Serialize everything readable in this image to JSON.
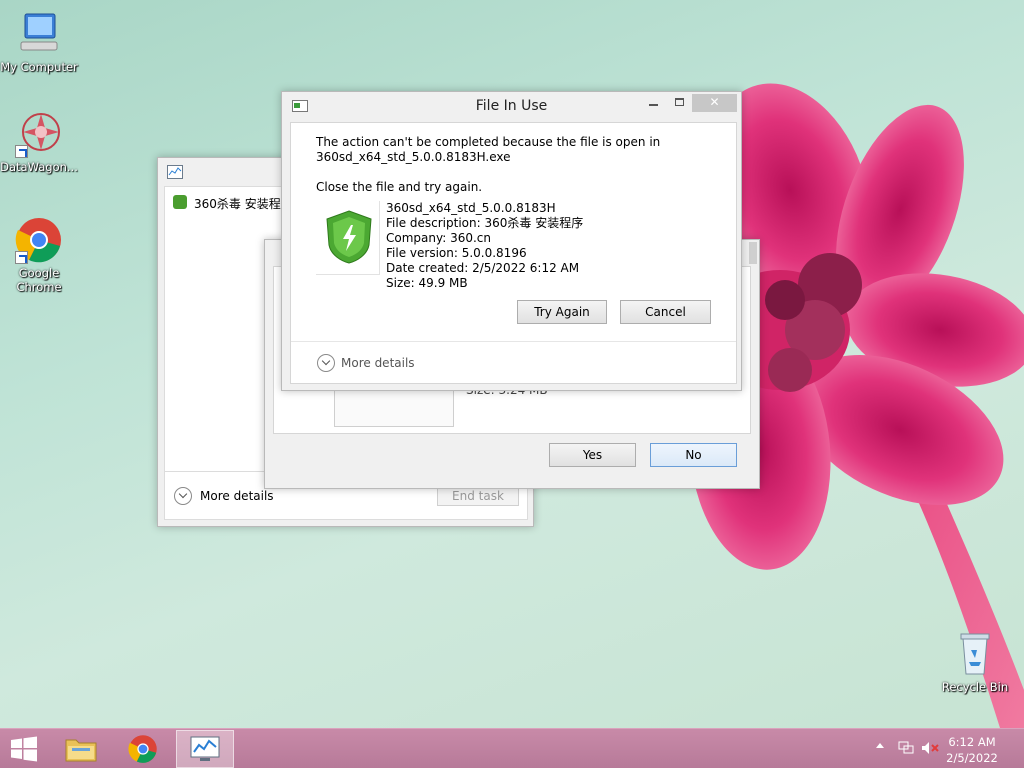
{
  "desktop": {
    "icons": [
      {
        "label": "My Computer"
      },
      {
        "label": "DataWagon..."
      },
      {
        "label": "Google Chrome"
      },
      {
        "label": "Recycle Bin"
      }
    ]
  },
  "taskmgr": {
    "item_label": "360杀毒 安装程序",
    "more_details": "More details",
    "end_task": "End task"
  },
  "confirm_dialog": {
    "size_fragment": "Size: 3.24 MB",
    "yes_label": "Yes",
    "no_label": "No"
  },
  "file_in_use": {
    "title": "File In Use",
    "message_line1": "The action can't be completed because the file is open in",
    "message_line2": "360sd_x64_std_5.0.0.8183H.exe",
    "message_line3": "Close the file and try again.",
    "file_name": "360sd_x64_std_5.0.0.8183H",
    "file_description": "File description: 360杀毒 安装程序",
    "company": "Company: 360.cn",
    "file_version": "File version: 5.0.0.8196",
    "date_created": "Date created: 2/5/2022 6:12 AM",
    "size": "Size: 49.9 MB",
    "try_again_label": "Try Again",
    "cancel_label": "Cancel",
    "more_details": "More details"
  },
  "taskbar": {
    "time": "6:12 AM",
    "date": "2/5/2022"
  },
  "colors": {
    "taskbar": "#b77a99",
    "flower": "#e0327a",
    "accent_button_border": "#6a9ed8"
  }
}
